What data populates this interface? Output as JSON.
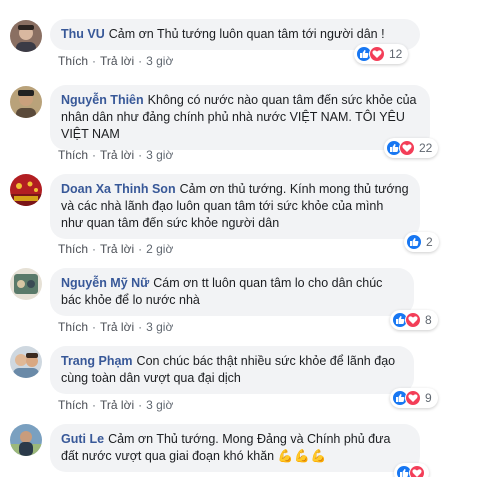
{
  "actions": {
    "like": "Thích",
    "reply": "Trả lời",
    "dot": "·"
  },
  "colors": {
    "link": "#385898",
    "bubble": "#f2f3f5",
    "like": "#1877f2",
    "love": "#f33e58"
  },
  "comments": [
    {
      "author": "Thu VU",
      "text": "Cảm ơn Thủ tướng luôn quan tâm tới người dân !",
      "time": "3 giờ",
      "reactions": [
        "like",
        "love"
      ],
      "count": "12"
    },
    {
      "author": "Nguyễn Thiên",
      "text": "Không có nước nào quan tâm đến sức khỏe của nhân dân như đảng chính phủ nhà nước VIỆT NAM. TÔI YÊU VIỆT NAM",
      "time": "3 giờ",
      "reactions": [
        "like",
        "love"
      ],
      "count": "22"
    },
    {
      "author": "Doan Xa Thinh Son",
      "text": "Cảm ơn thủ tướng. Kính mong thủ tướng và các nhà lãnh đạo luôn quan tâm tới sức khỏe của mình như quan tâm đến sức khỏe người dân",
      "time": "2 giờ",
      "reactions": [
        "like"
      ],
      "count": "2"
    },
    {
      "author": "Nguyễn Mỹ Nữ",
      "text": "Cám ơn tt luôn quan tâm lo cho dân chúc bác khỏe để lo nước nhà",
      "time": "3 giờ",
      "reactions": [
        "like",
        "love"
      ],
      "count": "8"
    },
    {
      "author": "Trang Phạm",
      "text": "Con chúc bác thật nhiều sức khỏe để lãnh đạo cùng toàn dân vượt qua đại dịch",
      "time": "3 giờ",
      "reactions": [
        "like",
        "love"
      ],
      "count": "9"
    },
    {
      "author": "Guti Le",
      "text": "Cảm ơn Thủ tướng. Mong Đảng và Chính phủ đưa đất nước vượt qua giai đoạn khó khăn",
      "emoji": "💪💪💪",
      "time": "",
      "reactions": [
        "like",
        "love"
      ],
      "count": ""
    }
  ]
}
